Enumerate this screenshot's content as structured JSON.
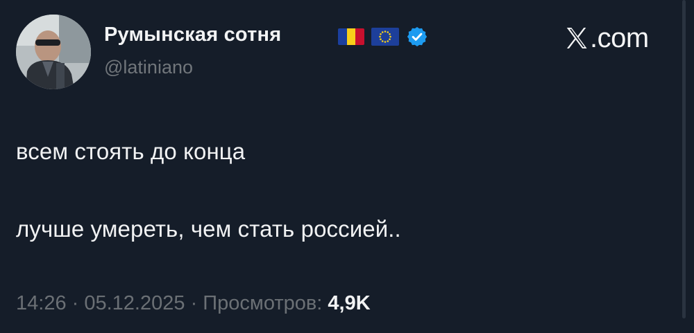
{
  "author": {
    "display_name": "Румынская сотня",
    "handle": "@latiniano",
    "badges": [
      "romania-flag",
      "eu-flag",
      "verified-badge"
    ]
  },
  "site": {
    "label": ".com",
    "logo": "x-logo-icon"
  },
  "tweet": {
    "line1": "всем стоять до конца",
    "line2": "лучше умереть, чем стать россией.."
  },
  "meta": {
    "time": "14:26",
    "separator": " · ",
    "date": "05.12.2025",
    "views_label": "Просмотров:",
    "views_count": "4,9K"
  },
  "colors": {
    "background": "#151d29",
    "verified": "#1d9bf0",
    "muted_text": "#71767b"
  }
}
